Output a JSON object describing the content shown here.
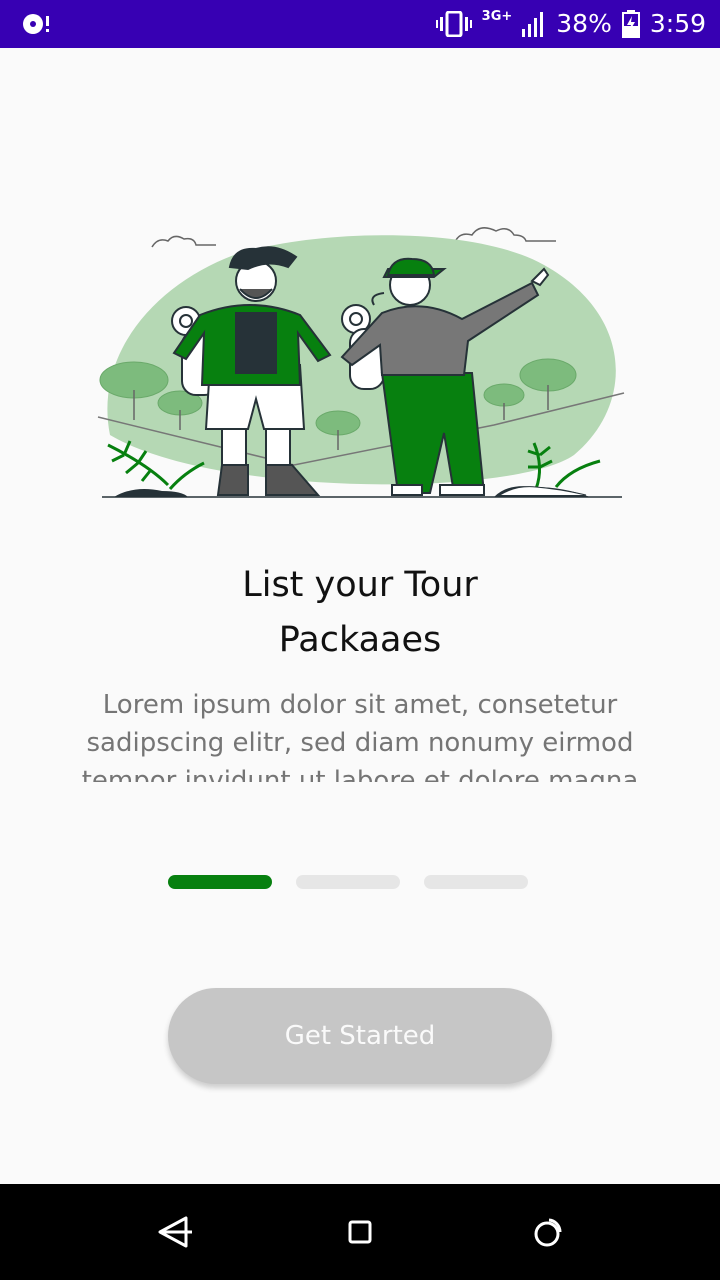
{
  "status_bar": {
    "network": "3G+",
    "battery": "38%",
    "time": "3:59"
  },
  "onboarding": {
    "title_line1": "List your Tour",
    "title_line2": "Packaaes",
    "description": "Lorem ipsum dolor sit amet, consetetur sadipscing elitr, sed diam nonumy eirmod tempor invidunt ut labore et dolore magna aliquyam erat.",
    "page_count": 3,
    "active_page": 1,
    "cta_label": "Get Started"
  },
  "colors": {
    "accent": "#07800f",
    "status_bar": "#3700b3",
    "button_bg": "#c6c6c6",
    "indicator_inactive": "#e6e6e6"
  },
  "icons": {
    "status_left": "music-disc-icon",
    "vibrate": "vibrate-icon",
    "signal": "signal-icon",
    "battery": "battery-charging-icon",
    "nav_back": "back-icon",
    "nav_home": "home-icon",
    "nav_recent": "recents-icon"
  }
}
